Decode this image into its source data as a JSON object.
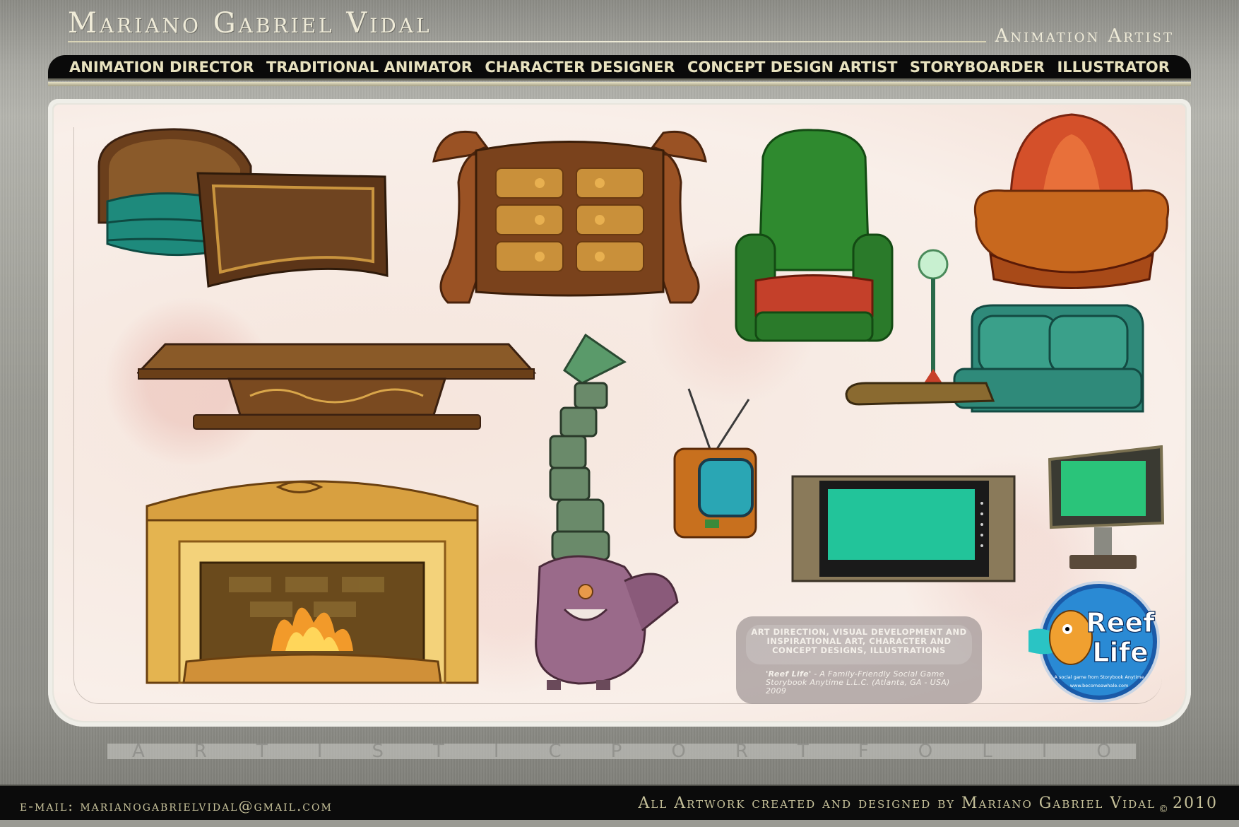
{
  "header": {
    "name": "Mariano Gabriel Vidal",
    "subtitle": "Animation Artist"
  },
  "nav": {
    "items": [
      {
        "label": "ANIMATION DIRECTOR"
      },
      {
        "label": "TRADITIONAL ANIMATOR"
      },
      {
        "label": "CHARACTER DESIGNER"
      },
      {
        "label": "CONCEPT DESIGN ARTIST"
      },
      {
        "label": "STORYBOARDER"
      },
      {
        "label": "ILLUSTRATOR"
      }
    ]
  },
  "credits": {
    "line1": "ART DIRECTION, VISUAL DEVELOPMENT AND INSPIRATIONAL ART, CHARACTER AND CONCEPT DESIGNS, ILLUSTRATIONS",
    "project": "'Reef Life'",
    "description": " - A Family-Friendly Social Game Storybook Anytime L.L.C. (Atlanta, GA - USA) 2009"
  },
  "logo": {
    "line1": "Reef",
    "line2": "Life",
    "tagline": "A social game from Storybook Anytime",
    "url": "www.becomeawhale.com"
  },
  "portfolio_banner": [
    "A",
    "R",
    "T",
    "I",
    "S",
    "T",
    "I",
    "C",
    "P",
    "O",
    "R",
    "T",
    "F",
    "O",
    "L",
    "I",
    "O"
  ],
  "footer": {
    "email": "e-mail: marianogabrielvidal@gmail.com",
    "copyright": "All Artwork created and designed by Mariano Gabriel Vidal",
    "cmark": "©",
    "year": "2010"
  },
  "colors": {
    "nav_bg": "#0a0a0a",
    "nav_text": "#e8e2bf",
    "teal": "#1f8a7a",
    "wood": "#7a4a22",
    "gold": "#d9a64a",
    "green_chair": "#3a8a3a",
    "orange_chair": "#d9602a"
  }
}
